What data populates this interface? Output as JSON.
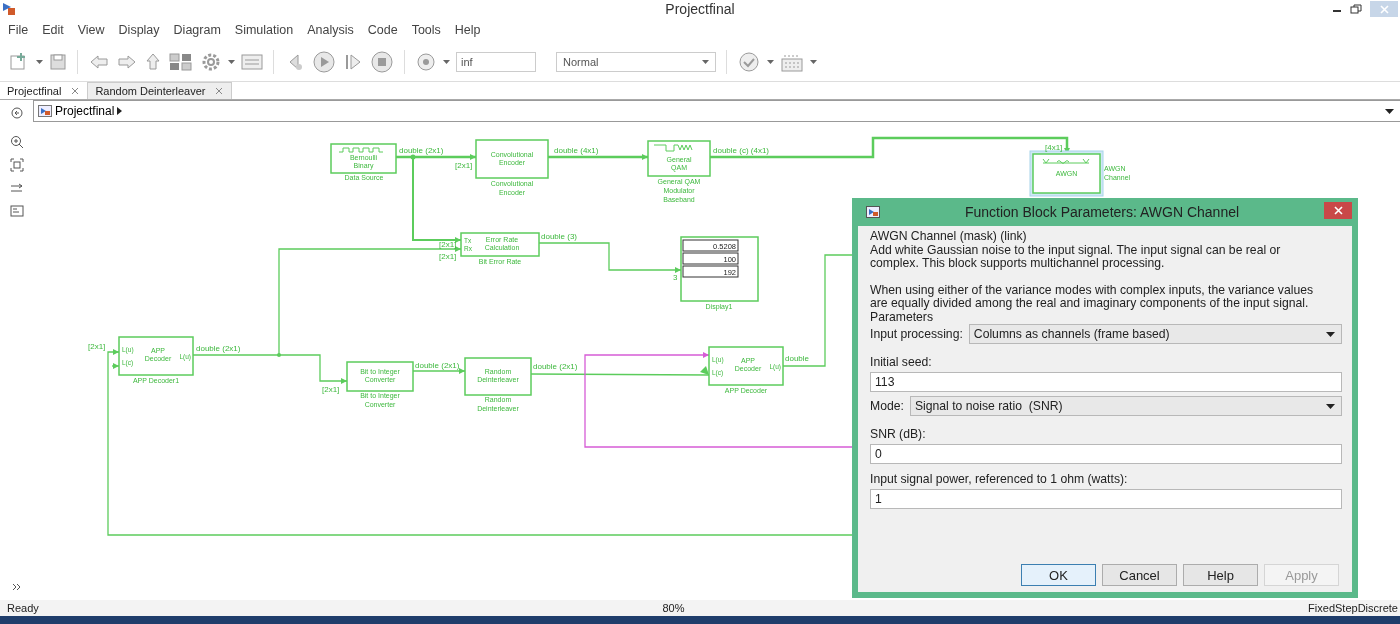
{
  "window": {
    "title": "Projectfinal"
  },
  "menu": [
    "File",
    "Edit",
    "View",
    "Display",
    "Diagram",
    "Simulation",
    "Analysis",
    "Code",
    "Tools",
    "Help"
  ],
  "toolbar": {
    "stop_time": "inf",
    "sim_mode": "Normal"
  },
  "tabs": [
    {
      "label": "Projectfinal",
      "selected": true
    },
    {
      "label": "Random Deinterleaver",
      "selected": false
    }
  ],
  "breadcrumb": "Projectfinal",
  "blocks": [
    {
      "kind": "block",
      "text": [
        "Bernoulli",
        "Binary"
      ],
      "caption": [
        "Data Source"
      ],
      "selected": false
    },
    {
      "kind": "block",
      "text": [
        "Convolutional",
        "Encoder"
      ],
      "caption": [
        "Convolutional",
        "Encoder"
      ],
      "selected": false
    },
    {
      "kind": "block",
      "text": [
        "General",
        "QAM"
      ],
      "caption": [
        "General QAM",
        "Modulator",
        "Baseband"
      ],
      "selected": false
    },
    {
      "kind": "block",
      "text": [
        "AWGN"
      ],
      "caption": [
        "AWGN",
        "Channel"
      ],
      "selected": true
    },
    {
      "kind": "block",
      "text": [
        "Error Rate",
        "Calculation"
      ],
      "in_ports": [
        "Tx",
        "Rx"
      ],
      "caption": [
        "Bit Error Rate"
      ],
      "selected": false
    },
    {
      "kind": "display",
      "values": [
        "0.5208",
        "100",
        "192"
      ],
      "caption": [
        "Display1"
      ],
      "selected": false
    },
    {
      "kind": "block",
      "text": [
        "APP",
        "Decoder"
      ],
      "in_ports": [
        "L(u)",
        "L(c)"
      ],
      "out_ports": [
        "L(u)"
      ],
      "caption": [
        "APP Decoder1"
      ],
      "selected": false
    },
    {
      "kind": "block",
      "text": [
        "Bit to Integer",
        "Converter"
      ],
      "caption": [
        "Bit to Integer",
        "Converter"
      ],
      "selected": false
    },
    {
      "kind": "block",
      "text": [
        "Random",
        "Deinterleaver"
      ],
      "caption": [
        "Random",
        "Deinterleaver"
      ],
      "selected": false
    },
    {
      "kind": "block",
      "text": [
        "APP",
        "Decoder"
      ],
      "in_ports": [
        "L(u)",
        "L(c)"
      ],
      "out_ports": [
        "L(u)"
      ],
      "caption": [
        "APP Decoder"
      ],
      "selected": false
    }
  ],
  "signal_labels": [
    "double (2x1)",
    "[2x1]",
    "double (4x1)",
    "double (c) (4x1)",
    "[4x1]",
    "double (3)",
    "[2x1]",
    "[2x1]",
    "3",
    "[2x1]",
    "double (2x1)",
    "[2x1]",
    "double (2x1)",
    "double (2x1)",
    "double"
  ],
  "dialog": {
    "title": "Function Block Parameters: AWGN Channel",
    "heading": "AWGN Channel (mask) (link)",
    "description": [
      "Add white Gaussian noise to the input signal. The input signal can be real or complex. This block supports multichannel processing.",
      "When using either of the variance modes with complex inputs, the variance values are equally divided among the real and imaginary components of the input signal."
    ],
    "parameters_heading": "Parameters",
    "params": [
      {
        "kind": "dropdown",
        "label": "Input processing:",
        "value": "Columns as channels (frame based)"
      },
      {
        "kind": "text",
        "label": "Initial seed:",
        "value": "113"
      },
      {
        "kind": "dropdown",
        "label": "Mode:",
        "value": "Signal to noise ratio  (SNR)"
      },
      {
        "kind": "text",
        "label": "SNR (dB):",
        "value": "0"
      },
      {
        "kind": "text",
        "label": "Input signal power, referenced to 1 ohm (watts):",
        "value": "1"
      }
    ],
    "buttons": [
      {
        "label": "OK",
        "disabled": false
      },
      {
        "label": "Cancel",
        "disabled": false
      },
      {
        "label": "Help",
        "disabled": false
      },
      {
        "label": "Apply",
        "disabled": true
      }
    ]
  },
  "status_bar": {
    "state": "Ready",
    "zoom": "80%",
    "solver": "FixedStepDiscrete"
  }
}
